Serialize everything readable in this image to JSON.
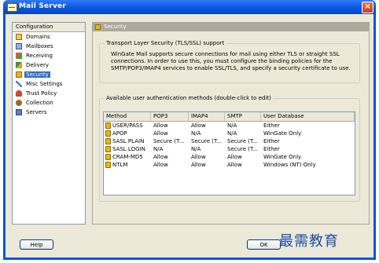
{
  "window": {
    "title": "Mail Server",
    "close_glyph": "×"
  },
  "sidebar": {
    "header": "Configuration",
    "items": [
      {
        "label": "Domains",
        "icon": "domains-icon"
      },
      {
        "label": "Mailboxes",
        "icon": "mailboxes-icon"
      },
      {
        "label": "Receiving",
        "icon": "receiving-icon"
      },
      {
        "label": "Delivery",
        "icon": "delivery-icon"
      },
      {
        "label": "Security",
        "icon": "lock-icon",
        "selected": true
      },
      {
        "label": "Misc Settings",
        "icon": "wrench-icon"
      },
      {
        "label": "Trust Policy",
        "icon": "trust-policy-icon"
      },
      {
        "label": "Collection",
        "icon": "collection-icon"
      },
      {
        "label": "Servers",
        "icon": "servers-icon"
      }
    ]
  },
  "panel": {
    "header": "Security",
    "tls": {
      "title": "Transport Layer Security (TLS/SSL) support",
      "description": "WinGate Mail supports secure connections for mail using either TLS or straight SSL connections. In order to use this, you must configure the binding policies for the SMTP/POP3/IMAP4 services to enable SSL/TLS, and specify a security certificate to use."
    },
    "auth": {
      "title": "Available user authentication methods (double-click to edit)",
      "columns": [
        "Method",
        "POP3",
        "IMAP4",
        "SMTP",
        "User Database"
      ],
      "rows": [
        [
          "USER/PASS",
          "Allow",
          "Allow",
          "N/A",
          "Either"
        ],
        [
          "APOP",
          "Allow",
          "N/A",
          "N/A",
          "WinGate Only"
        ],
        [
          "SASL PLAIN",
          "Secure (T...",
          "Secure (T...",
          "Secure (T...",
          "Either"
        ],
        [
          "SASL LOGIN",
          "N/A",
          "N/A",
          "Secure (T...",
          "Either"
        ],
        [
          "CRAM-MD5",
          "Allow",
          "Allow",
          "Allow",
          "WinGate Only"
        ],
        [
          "NTLM",
          "Allow",
          "Allow",
          "Allow",
          "Windows (NT) Only"
        ]
      ]
    }
  },
  "buttons": {
    "help": "Help",
    "ok": "OK"
  },
  "watermark": "最需教育",
  "colors": {
    "titlebar": "#0a55e0",
    "selection": "#316ac5",
    "dialog_bg": "#ece9d8",
    "watermark": "#1d4ea8"
  }
}
